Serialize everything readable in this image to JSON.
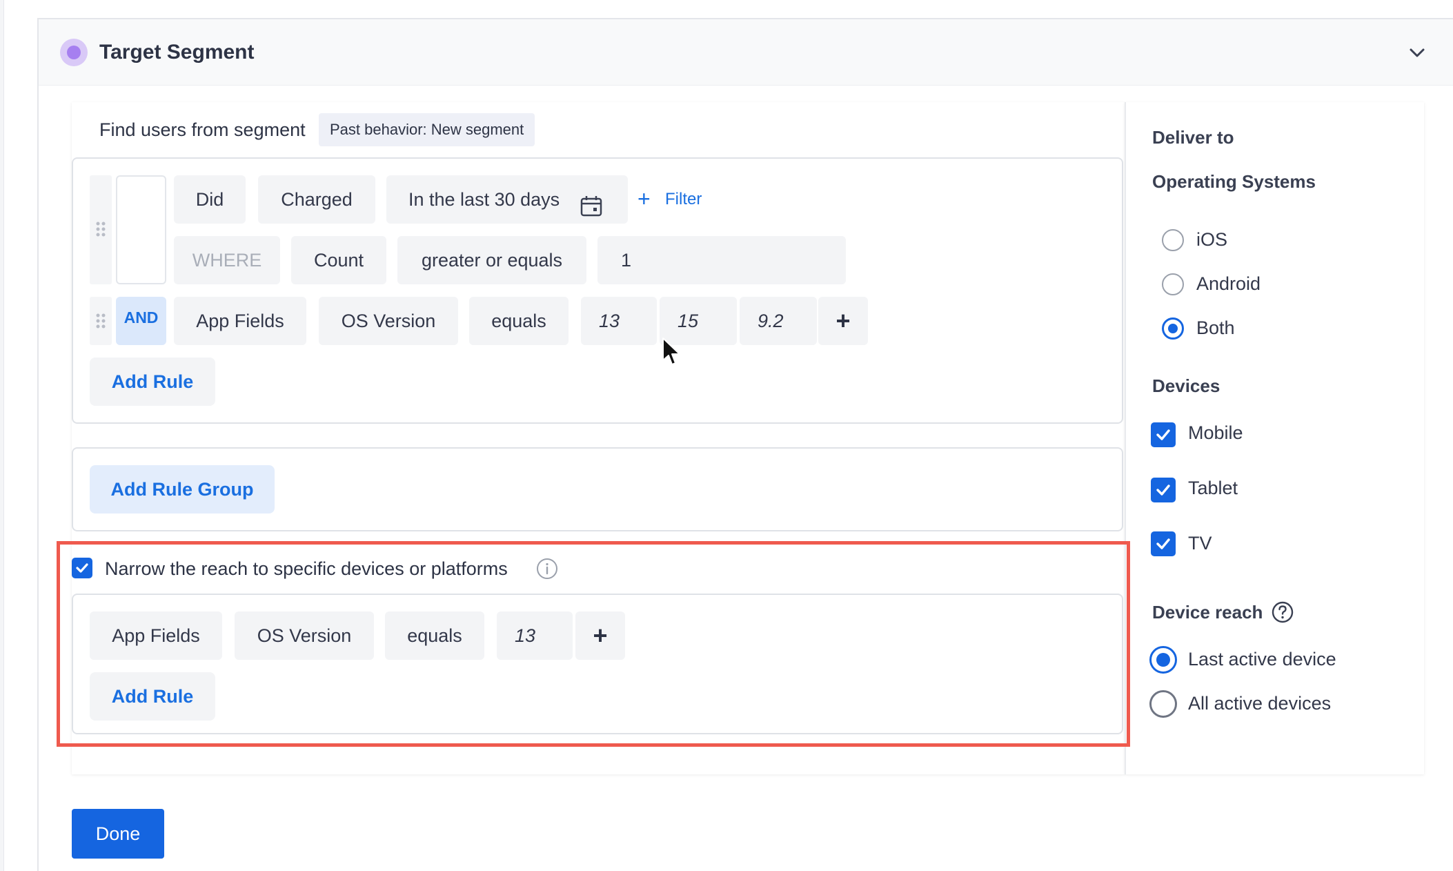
{
  "header": {
    "title": "Target Segment"
  },
  "segment": {
    "find_label": "Find users from segment",
    "chip": "Past behavior: New segment"
  },
  "rule1": {
    "did": "Did",
    "event": "Charged",
    "time_range": "In the last 30 days",
    "filter_label": "Filter",
    "where": "WHERE",
    "count": "Count",
    "operator": "greater or equals",
    "value": "1"
  },
  "rule2": {
    "conjunction": "AND",
    "field_group": "App Fields",
    "field": "OS Version",
    "operator": "equals",
    "values": [
      "13",
      "15",
      "9.2"
    ],
    "plus": "+"
  },
  "add_rule_label": "Add Rule",
  "add_rule_group_label": "Add Rule Group",
  "narrow": {
    "checked": true,
    "label": "Narrow the reach to specific devices or platforms",
    "rule": {
      "field_group": "App Fields",
      "field": "OS Version",
      "operator": "equals",
      "value": "13",
      "plus": "+"
    },
    "add_rule_label": "Add Rule"
  },
  "deliver": {
    "title": "Deliver to",
    "os_title": "Operating Systems",
    "os_options": [
      {
        "label": "iOS",
        "selected": false
      },
      {
        "label": "Android",
        "selected": false
      },
      {
        "label": "Both",
        "selected": true
      }
    ],
    "devices_title": "Devices",
    "devices": [
      {
        "label": "Mobile",
        "checked": true
      },
      {
        "label": "Tablet",
        "checked": true
      },
      {
        "label": "TV",
        "checked": true
      }
    ],
    "reach_title": "Device reach",
    "reach_options": [
      {
        "label": "Last active device",
        "selected": true
      },
      {
        "label": "All active devices",
        "selected": false
      }
    ]
  },
  "done_label": "Done",
  "colors": {
    "accent": "#1565e0",
    "highlight": "#ef5a4e",
    "segment_icon": "#a67ff0"
  },
  "icons": {
    "segment": "segment-dot-icon",
    "collapse": "chevron-down-icon",
    "calendar": "calendar-icon",
    "add": "plus-icon",
    "drag": "drag-handle-icon",
    "info": "info-icon",
    "help": "question-icon",
    "check": "check-icon",
    "cursor": "mouse-pointer-icon"
  }
}
